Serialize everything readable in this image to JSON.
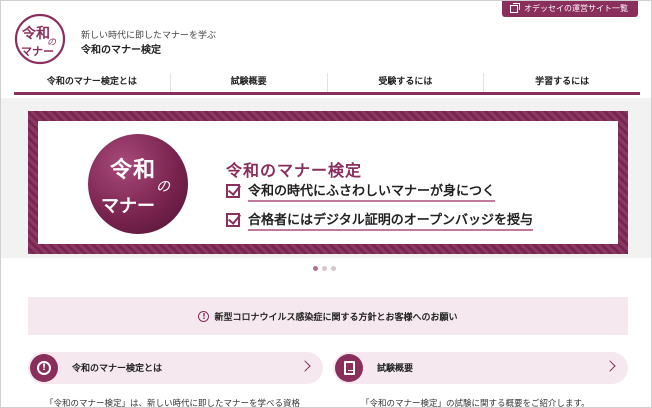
{
  "header": {
    "tagline": "新しい時代に即したマナーを学ぶ",
    "site_title": "令和のマナー検定",
    "ext_link": "オデッセイの運営サイト一覧",
    "logo_text_top": "令和",
    "logo_text_no": "の",
    "logo_text_bottom": "マナー"
  },
  "nav": {
    "items": [
      {
        "label": "令和のマナー検定とは"
      },
      {
        "label": "試験概要"
      },
      {
        "label": "受験するには"
      },
      {
        "label": "学習するには"
      }
    ]
  },
  "hero": {
    "logo_text_top": "令和",
    "logo_text_no": "の",
    "logo_text_bottom": "マナー",
    "heading": "令和のマナー検定",
    "points": [
      "令和の時代にふさわしいマナーが身につく",
      "合格者にはデジタル証明のオープンバッジを授与"
    ],
    "slides_total": 3,
    "slide_active": 1
  },
  "notice": {
    "text": "新型コロナウイルス感染症に関する方針とお客様へのお願い",
    "icon": "exclamation-circle-icon"
  },
  "cards": [
    {
      "label": "令和のマナー検定とは",
      "icon": "exclamation-icon",
      "desc": "「令和のマナー検定」は、新しい時代に即したマナーを学べる資格"
    },
    {
      "label": "試験概要",
      "icon": "document-icon",
      "desc": "「令和のマナー検定」の試験に関する概要をご紹介します。"
    }
  ],
  "colors": {
    "accent": "#8a2e5c",
    "accent_light": "#f5e9ef"
  }
}
